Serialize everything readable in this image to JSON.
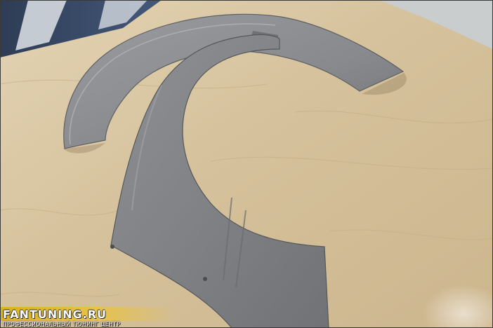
{
  "photo": {
    "subject": "",
    "colors": {
      "plywood": "#d8c6a2",
      "part_gray": "#8a8c8f",
      "part_shadow": "#5e6064",
      "wall_blue": "#35465e"
    }
  },
  "watermark": {
    "logo": "FANTUNING.RU",
    "tagline": "ПРОФЕССИОНАЛЬНЫЙ ТЮНИНГ ЦЕНТР",
    "accent": "#e0b92e"
  }
}
